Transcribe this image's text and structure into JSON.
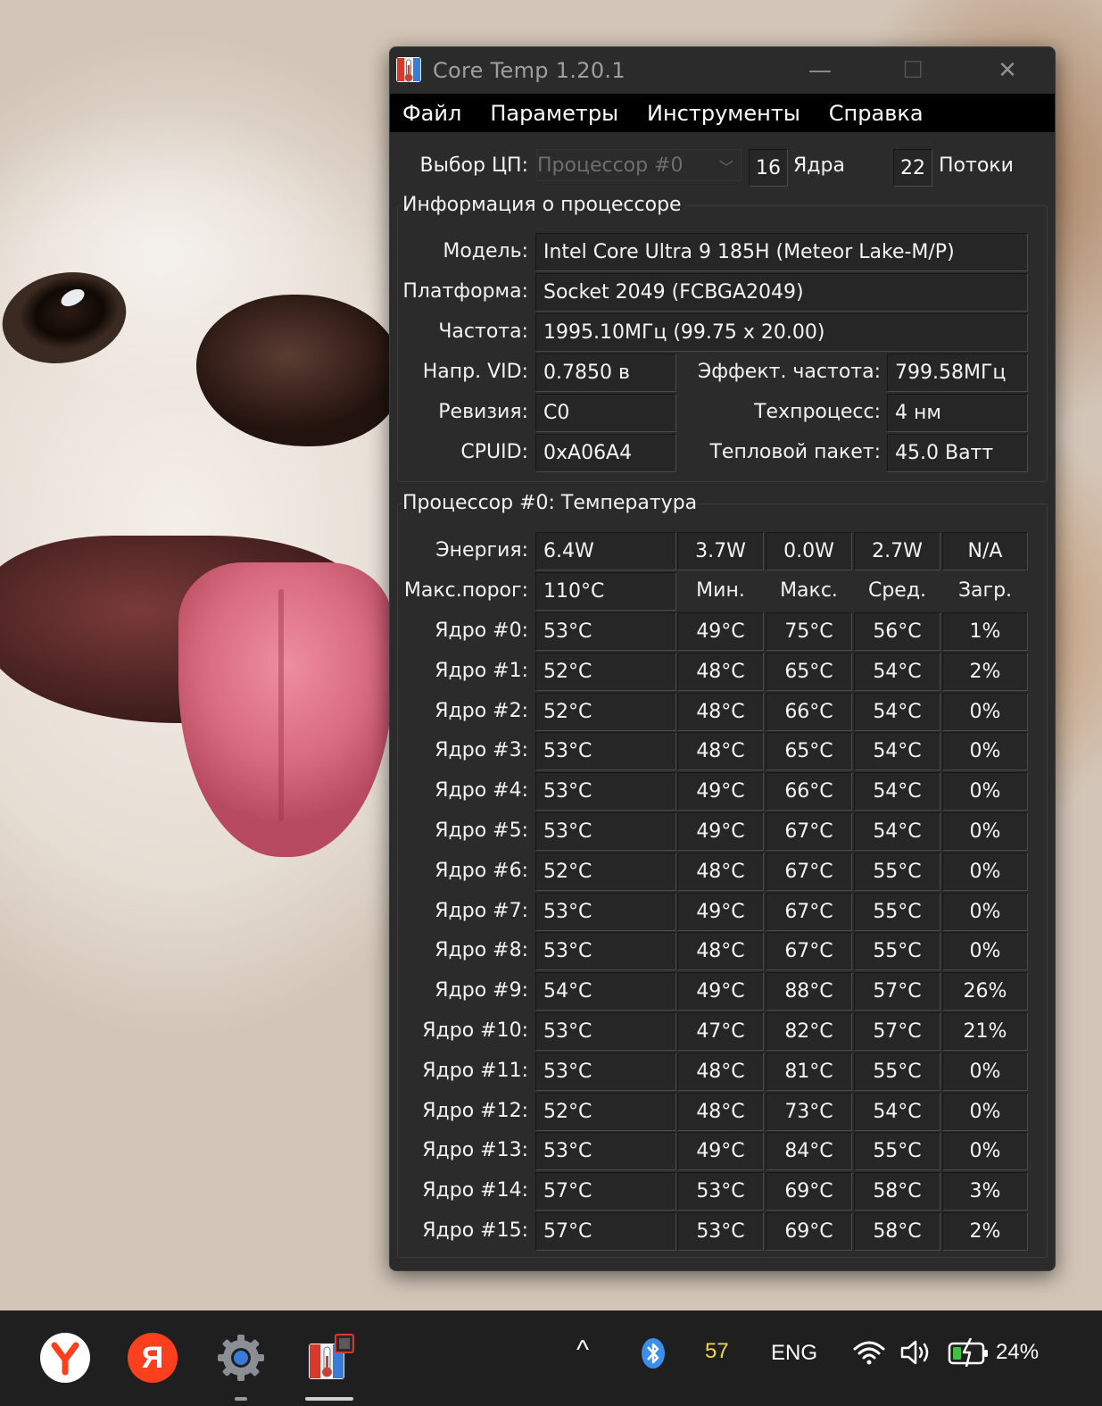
{
  "window": {
    "title": "Core Temp 1.20.1",
    "controls": {
      "minimize": "—",
      "maximize": "☐",
      "close": "✕"
    }
  },
  "menu": [
    "Файл",
    "Параметры",
    "Инструменты",
    "Справка"
  ],
  "cpu_select": {
    "label": "Выбор ЦП:",
    "value": "Процессор #0",
    "cores_value": "16",
    "cores_label": "Ядра",
    "threads_value": "22",
    "threads_label": "Потоки"
  },
  "processor_info": {
    "title": "Информация о процессоре",
    "model_label": "Модель:",
    "model": "Intel Core Ultra 9 185H (Meteor Lake-M/P)",
    "platform_label": "Платформа:",
    "platform": "Socket 2049 (FCBGA2049)",
    "frequency_label": "Частота:",
    "frequency": "1995.10МГц (99.75 x 20.00)",
    "vid_label": "Напр. VID:",
    "vid": "0.7850 в",
    "eff_freq_label": "Эффект. частота:",
    "eff_freq": "799.58МГц",
    "revision_label": "Ревизия:",
    "revision": "C0",
    "lithography_label": "Техпроцесс:",
    "lithography": "4 нм",
    "cpuid_label": "CPUID:",
    "cpuid": "0xA06A4",
    "tdp_label": "Тепловой пакет:",
    "tdp": "45.0 Ватт"
  },
  "temperature": {
    "title": "Процессор #0: Температура",
    "power_label": "Энергия:",
    "power": [
      "6.4W",
      "3.7W",
      "0.0W",
      "2.7W",
      "N/A"
    ],
    "tjmax_label": "Макс.порог:",
    "tjmax": "110°C",
    "headers": [
      "Мин.",
      "Макс.",
      "Сред.",
      "Загр."
    ],
    "cores": [
      {
        "label": "Ядро #0:",
        "temp": "53°C",
        "min": "49°C",
        "max": "75°C",
        "avg": "56°C",
        "load": "1%"
      },
      {
        "label": "Ядро #1:",
        "temp": "52°C",
        "min": "48°C",
        "max": "65°C",
        "avg": "54°C",
        "load": "2%"
      },
      {
        "label": "Ядро #2:",
        "temp": "52°C",
        "min": "48°C",
        "max": "66°C",
        "avg": "54°C",
        "load": "0%"
      },
      {
        "label": "Ядро #3:",
        "temp": "53°C",
        "min": "48°C",
        "max": "65°C",
        "avg": "54°C",
        "load": "0%"
      },
      {
        "label": "Ядро #4:",
        "temp": "53°C",
        "min": "49°C",
        "max": "66°C",
        "avg": "54°C",
        "load": "0%"
      },
      {
        "label": "Ядро #5:",
        "temp": "53°C",
        "min": "49°C",
        "max": "67°C",
        "avg": "54°C",
        "load": "0%"
      },
      {
        "label": "Ядро #6:",
        "temp": "52°C",
        "min": "48°C",
        "max": "67°C",
        "avg": "55°C",
        "load": "0%"
      },
      {
        "label": "Ядро #7:",
        "temp": "53°C",
        "min": "49°C",
        "max": "67°C",
        "avg": "55°C",
        "load": "0%"
      },
      {
        "label": "Ядро #8:",
        "temp": "53°C",
        "min": "48°C",
        "max": "67°C",
        "avg": "55°C",
        "load": "0%"
      },
      {
        "label": "Ядро #9:",
        "temp": "54°C",
        "min": "49°C",
        "max": "88°C",
        "avg": "57°C",
        "load": "26%"
      },
      {
        "label": "Ядро #10:",
        "temp": "53°C",
        "min": "47°C",
        "max": "82°C",
        "avg": "57°C",
        "load": "21%"
      },
      {
        "label": "Ядро #11:",
        "temp": "53°C",
        "min": "48°C",
        "max": "81°C",
        "avg": "55°C",
        "load": "0%"
      },
      {
        "label": "Ядро #12:",
        "temp": "52°C",
        "min": "48°C",
        "max": "73°C",
        "avg": "54°C",
        "load": "0%"
      },
      {
        "label": "Ядро #13:",
        "temp": "53°C",
        "min": "49°C",
        "max": "84°C",
        "avg": "55°C",
        "load": "0%"
      },
      {
        "label": "Ядро #14:",
        "temp": "57°C",
        "min": "53°C",
        "max": "69°C",
        "avg": "58°C",
        "load": "3%"
      },
      {
        "label": "Ядро #15:",
        "temp": "57°C",
        "min": "53°C",
        "max": "69°C",
        "avg": "58°C",
        "load": "2%"
      }
    ]
  },
  "taskbar": {
    "apps": [
      "yandex-browser-icon",
      "yandex-icon",
      "settings-icon",
      "coretemp-icon"
    ],
    "tray": {
      "chevron": "^",
      "coretemp_tray_temp": "57",
      "language": "ENG",
      "battery_percent": "24%"
    }
  },
  "colors": {
    "window_bg": "#2b2b2b",
    "menubar_bg": "#000000",
    "field_bg": "#262626",
    "taskbar_bg": "#1f1f1f",
    "tray_temp": "#f5d64a",
    "bluetooth": "#3b8eea",
    "battery_charge": "#3fc23f"
  }
}
